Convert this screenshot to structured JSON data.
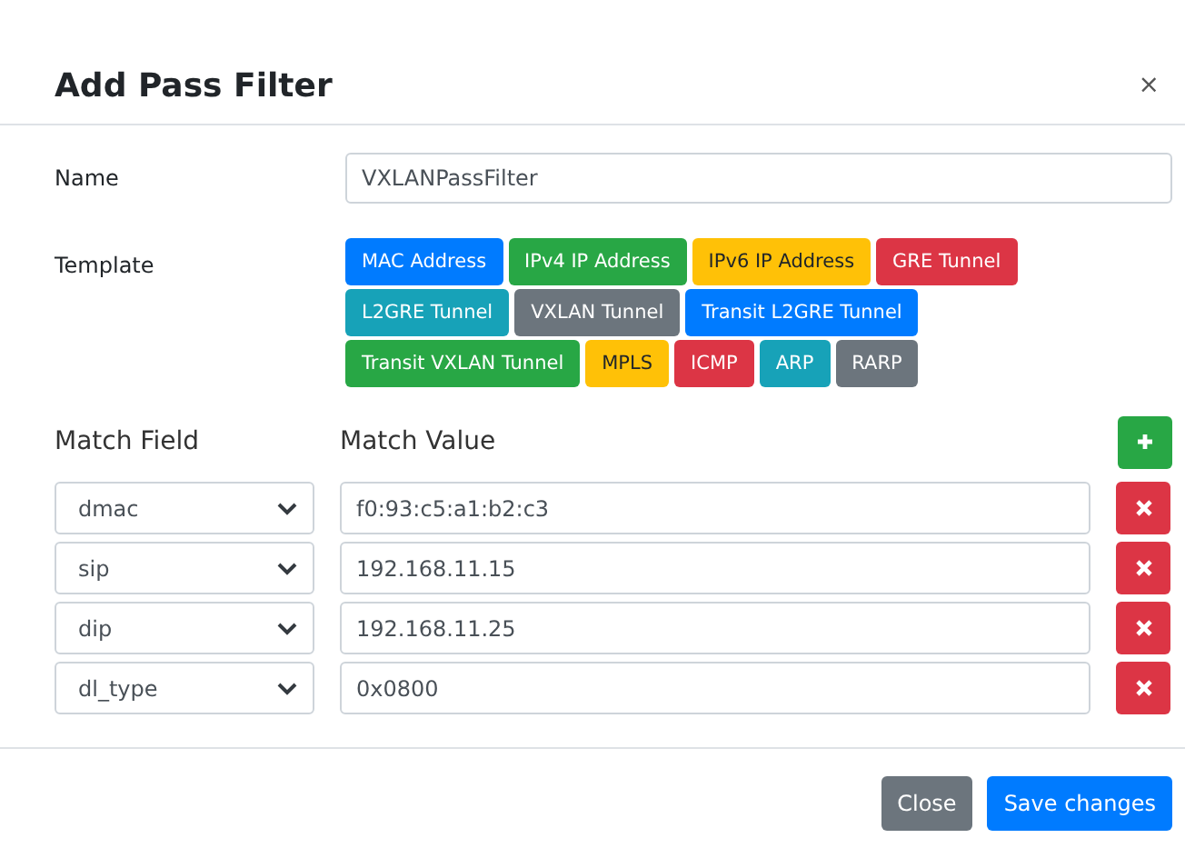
{
  "dialog": {
    "title": "Add Pass Filter",
    "close": "×"
  },
  "name_field": {
    "label": "Name",
    "value": "VXLANPassFilter"
  },
  "template": {
    "label": "Template",
    "options": [
      {
        "label": "MAC Address",
        "color": "#007bff"
      },
      {
        "label": "IPv4 IP Address",
        "color": "#28a745"
      },
      {
        "label": "IPv6 IP Address",
        "color": "#ffc107"
      },
      {
        "label": "GRE Tunnel",
        "color": "#dc3545"
      },
      {
        "label": "L2GRE Tunnel",
        "color": "#17a2b8"
      },
      {
        "label": "VXLAN Tunnel",
        "color": "#6c757d"
      },
      {
        "label": "Transit L2GRE Tunnel",
        "color": "#007bff"
      },
      {
        "label": "Transit VXLAN Tunnel",
        "color": "#28a745"
      },
      {
        "label": "MPLS",
        "color": "#ffc107"
      },
      {
        "label": "ICMP",
        "color": "#dc3545"
      },
      {
        "label": "ARP",
        "color": "#17a2b8"
      },
      {
        "label": "RARP",
        "color": "#6c757d"
      }
    ]
  },
  "match": {
    "field_header": "Match Field",
    "value_header": "Match Value",
    "rows": [
      {
        "field": "dmac",
        "value": "f0:93:c5:a1:b2:c3"
      },
      {
        "field": "sip",
        "value": "192.168.11.15"
      },
      {
        "field": "dip",
        "value": "192.168.11.25"
      },
      {
        "field": "dl_type",
        "value": "0x0800"
      }
    ]
  },
  "buttons": [
    "Close",
    "Save changes"
  ]
}
